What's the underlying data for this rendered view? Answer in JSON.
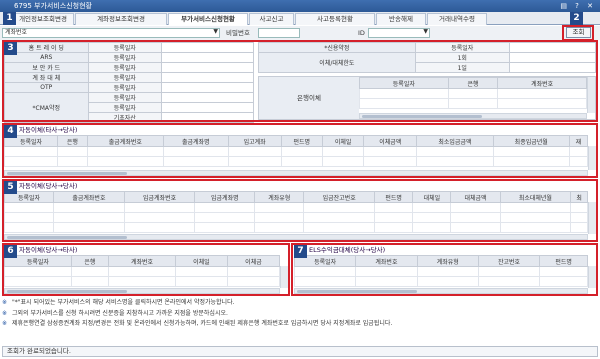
{
  "window": {
    "title": "6795 부가서비스신청현황",
    "controls": "▤ ? ✕"
  },
  "tabs": [
    "개인정보조회변경",
    "계좌정보조회변경",
    "부가서비스신청현황",
    "사고신고",
    "사고등록현황",
    "반송해제",
    "거래내역수령"
  ],
  "search": {
    "account_label": "계좌번호",
    "password_label": "비밀번호",
    "id_label": "ID",
    "query_button": "조회"
  },
  "markers": [
    "1",
    "2",
    "3",
    "4",
    "5",
    "6",
    "7"
  ],
  "services": {
    "col_header": "등록일자",
    "left_rows": [
      "홈 트 레 이 딩",
      "ARS",
      "보 안 카 드",
      "계 좌 대 체",
      "OTP"
    ],
    "cma": "*CMA약정",
    "cma_sub": [
      "등록일자",
      "등록일자",
      "기초자산"
    ],
    "credit": "*신용약정",
    "credit_date": "등록일자",
    "limit": "이체/대체한도",
    "limit_once": "1회",
    "limit_day": "1일",
    "bank": "은행이체",
    "bank_cols": [
      "등록일자",
      "은행",
      "계좌번호"
    ]
  },
  "sec4": {
    "title": "자동이체(타사→당사)",
    "cols": [
      "등록일자",
      "은행",
      "출금계좌번호",
      "출금계좌명",
      "입고계좌",
      "펀드명",
      "이체일",
      "이체금액",
      "최소입금금액",
      "최종입금년월",
      "재"
    ]
  },
  "sec5": {
    "title": "자동이체(당사→당사)",
    "cols": [
      "등록일자",
      "출금계좌번호",
      "입금계좌번호",
      "입금계좌명",
      "계좌유형",
      "입금잔고번호",
      "펀드명",
      "대체일",
      "대체금액",
      "최소대체년월",
      "최"
    ]
  },
  "sec6": {
    "title": "자동이체(당사→타사)",
    "cols": [
      "등록일자",
      "은행",
      "계좌번호",
      "이체일",
      "이체금"
    ]
  },
  "sec7": {
    "title": "ELS수익금대체(당사→당사)",
    "cols": [
      "등록일자",
      "계좌번호",
      "계좌유형",
      "잔고번호",
      "펀드명"
    ]
  },
  "notes": [
    "\"*\"표시 되어있는 부가서비스의 해당 서비스명을 클릭하시면 온라인에서 약정가능합니다.",
    "그외의 부가서비스를 신청 하시려면 신분증을 지참하시고 가까운 지점을 방문하십시오.",
    "제휴은행연결 삼성증권계좌 지정/변경은 전화 및 온라인에서 신청가능하며, 카드에 인쇄된 제휴은행 계좌번호로 입금하시면 당사 지정계좌로 입금됩니다."
  ],
  "note_mark": "※",
  "status": "조회가 완료되었습니다."
}
